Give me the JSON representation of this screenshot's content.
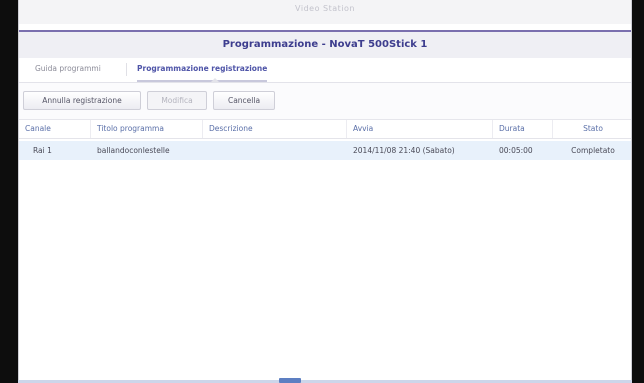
{
  "app": {
    "title": "Video Station"
  },
  "dialog": {
    "title": "Programmazione - NovaT 500Stick 1"
  },
  "tabs": [
    {
      "label": "Guida programmi"
    },
    {
      "label": "Programmazione registrazione"
    }
  ],
  "toolbar": {
    "cancel_recording_label": "Annulla registrazione",
    "edit_label": "Modifica",
    "delete_label": "Cancella"
  },
  "table": {
    "columns": [
      "Canale",
      "Titolo programma",
      "Descrizione",
      "Avvia",
      "Durata",
      "Stato"
    ],
    "rows": [
      {
        "channel": "Rai 1",
        "title": "ballandoconlestelle",
        "description": "",
        "start": "2014/11/08 21:40 (Sabato)",
        "duration": "00:05:00",
        "status": "Completato"
      }
    ]
  },
  "colors": {
    "accent": "#7a6fae",
    "title_text": "#3d3d8e",
    "header_text": "#5a6fa8",
    "selected_row": "#e8f1fb"
  }
}
